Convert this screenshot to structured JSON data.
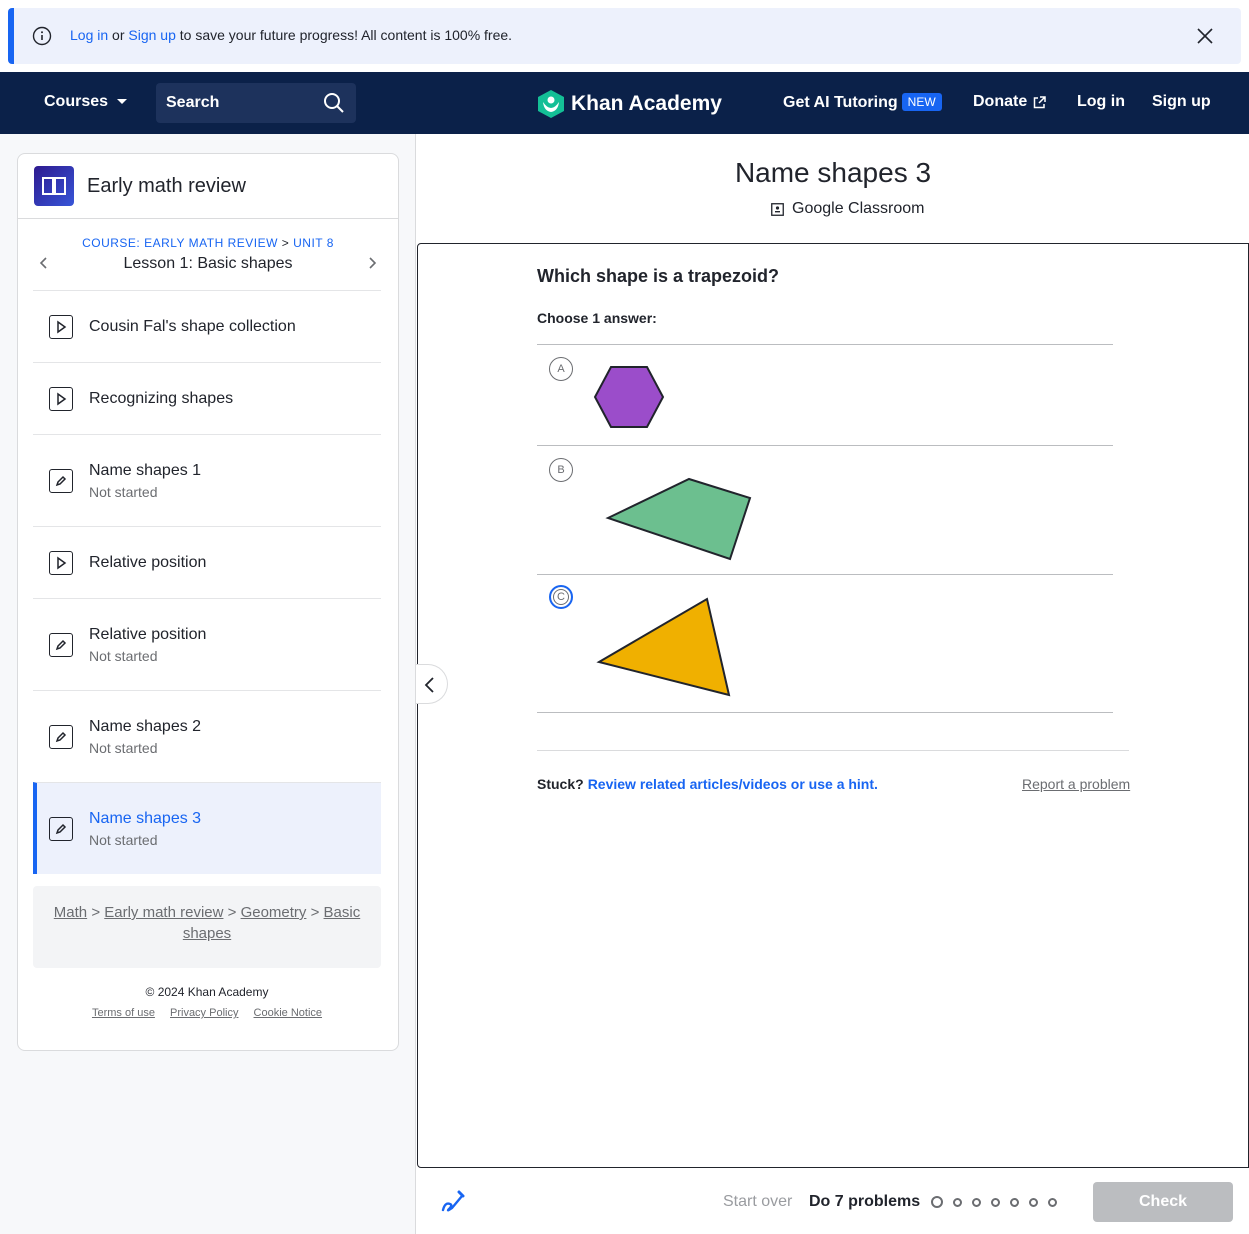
{
  "banner": {
    "login": "Log in",
    "or": "or",
    "signup": "Sign up",
    "rest": "to save your future progress! All content is 100% free."
  },
  "nav": {
    "courses": "Courses",
    "search": "Search",
    "brand": "Khan Academy",
    "tutoring": "Get AI Tutoring",
    "new_badge": "NEW",
    "donate": "Donate",
    "login": "Log in",
    "signup": "Sign up",
    "bg_color": "#0b2149"
  },
  "sidebar": {
    "course_title": "Early math review",
    "course_crumb": "COURSE: EARLY MATH REVIEW",
    "crumb_sep": ">",
    "unit": "UNIT 8",
    "lesson": "Lesson 1: Basic shapes",
    "items": [
      {
        "icon": "play-icon",
        "name": "Cousin Fal's shape collection",
        "status": ""
      },
      {
        "icon": "play-icon",
        "name": "Recognizing shapes",
        "status": ""
      },
      {
        "icon": "pencil-icon",
        "name": "Name shapes 1",
        "status": "Not started"
      },
      {
        "icon": "play-icon",
        "name": "Relative position",
        "status": ""
      },
      {
        "icon": "pencil-icon",
        "name": "Relative position",
        "status": "Not started"
      },
      {
        "icon": "pencil-icon",
        "name": "Name shapes 2",
        "status": "Not started"
      },
      {
        "icon": "pencil-icon",
        "name": "Name shapes 3",
        "status": "Not started"
      }
    ],
    "breadcrumbs": [
      "Math",
      "Early math review",
      "Geometry",
      "Basic shapes"
    ],
    "copyright": "© 2024 Khan Academy",
    "footer_links": [
      "Terms of use",
      "Privacy Policy",
      "Cookie Notice"
    ]
  },
  "exercise": {
    "title": "Name shapes 3",
    "google_classroom": "Google Classroom",
    "question": "Which shape is a trapezoid?",
    "choose": "Choose 1 answer:",
    "choices": [
      {
        "letter": "A",
        "shape": "hexagon",
        "color": "#9b4dca"
      },
      {
        "letter": "B",
        "shape": "quadrilateral",
        "color": "#6cbf8f"
      },
      {
        "letter": "C",
        "shape": "triangle",
        "color": "#f0b000"
      }
    ],
    "stuck": "Stuck?",
    "hint_link": "Review related articles/videos or use a hint.",
    "report": "Report a problem"
  },
  "footer": {
    "start_over": "Start over",
    "do_problems": "Do 7 problems",
    "check": "Check",
    "problem_dots": 7
  },
  "colors": {
    "accent": "#1865f2",
    "text": "#21242c"
  }
}
